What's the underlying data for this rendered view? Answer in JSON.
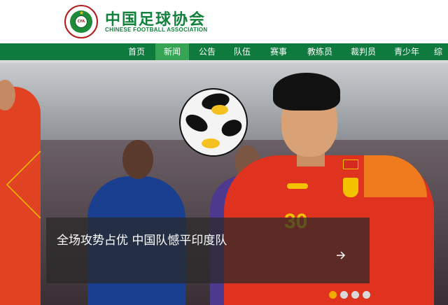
{
  "header": {
    "logo_cn": "中国足球协会",
    "logo_en": "CHINESE FOOTBALL ASSOCIATION",
    "badge_text": "CFA"
  },
  "nav": {
    "items": [
      {
        "label": "首页"
      },
      {
        "label": "新闻",
        "active": true
      },
      {
        "label": "公告"
      },
      {
        "label": "队伍"
      },
      {
        "label": "赛事"
      },
      {
        "label": "教练员"
      },
      {
        "label": "裁判员"
      },
      {
        "label": "青少年"
      },
      {
        "label": "综"
      }
    ]
  },
  "hero": {
    "caption": "全场攻势占优  中国队憾平印度队",
    "jersey_number": "30",
    "dots": {
      "count": 4,
      "active_index": 0
    }
  },
  "colors": {
    "brand_green": "#0f7a3d",
    "nav_active": "#35a455",
    "dot_active": "#f2a900"
  },
  "icons": [
    "prev-arrow-icon",
    "next-arrow-icon"
  ]
}
